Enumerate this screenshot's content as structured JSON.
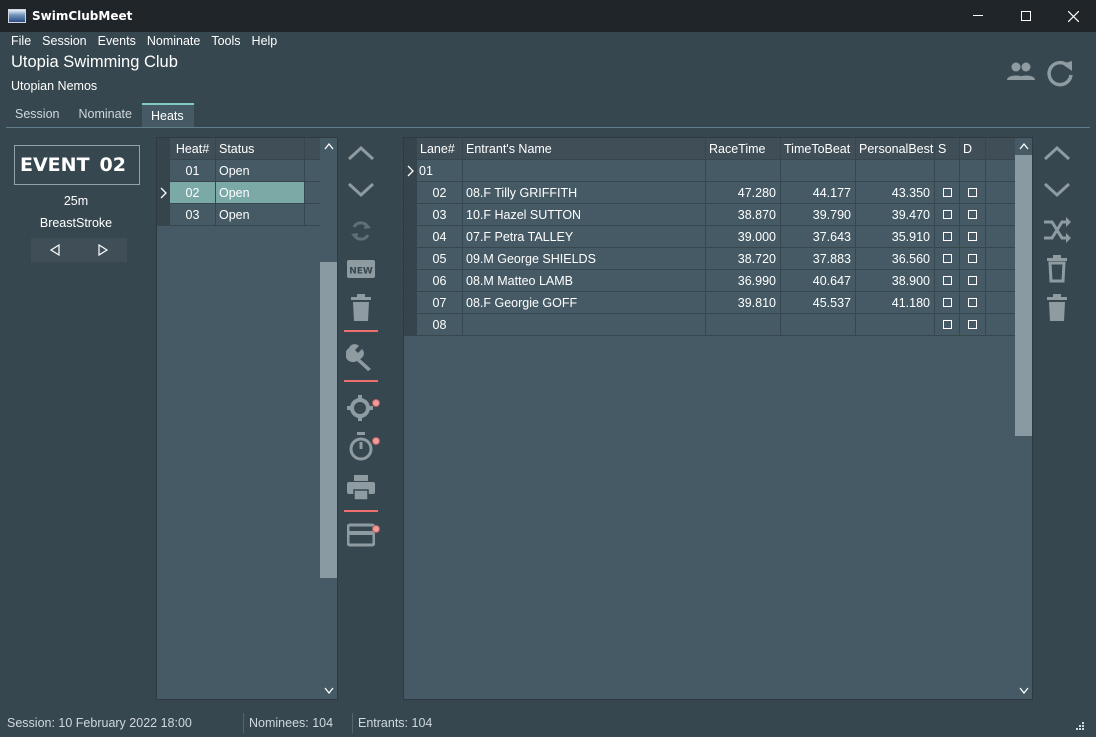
{
  "window": {
    "title": "SwimClubMeet"
  },
  "menu": [
    "File",
    "Session",
    "Events",
    "Nominate",
    "Tools",
    "Help"
  ],
  "header": {
    "club_name": "Utopia Swimming Club",
    "team_name": "Utopian Nemos"
  },
  "tabs": [
    {
      "label": "Session",
      "active": false
    },
    {
      "label": "Nominate",
      "active": false
    },
    {
      "label": "Heats",
      "active": true
    }
  ],
  "event": {
    "label": "EVENT",
    "number": "02",
    "distance": "25m",
    "stroke": "BreastStroke"
  },
  "heats": {
    "columns": [
      "Heat#",
      "Status"
    ],
    "rows": [
      {
        "heat": "01",
        "status": "Open"
      },
      {
        "heat": "02",
        "status": "Open"
      },
      {
        "heat": "03",
        "status": "Open"
      }
    ]
  },
  "lanes": {
    "columns": [
      "Lane#",
      "Entrant's Name",
      "RaceTime",
      "TimeToBeat",
      "PersonalBest",
      "S",
      "D"
    ],
    "rows": [
      {
        "lane": "01",
        "name": "",
        "race": "",
        "ttb": "",
        "pb": ""
      },
      {
        "lane": "02",
        "name": "08.F  Tilly GRIFFITH",
        "race": "47.280",
        "ttb": "44.177",
        "pb": "43.350"
      },
      {
        "lane": "03",
        "name": "10.F  Hazel SUTTON",
        "race": "38.870",
        "ttb": "39.790",
        "pb": "39.470"
      },
      {
        "lane": "04",
        "name": "07.F  Petra TALLEY",
        "race": "39.000",
        "ttb": "37.643",
        "pb": "35.910"
      },
      {
        "lane": "05",
        "name": "09.M  George SHIELDS",
        "race": "38.720",
        "ttb": "37.883",
        "pb": "36.560"
      },
      {
        "lane": "06",
        "name": "08.M  Matteo LAMB",
        "race": "36.990",
        "ttb": "40.647",
        "pb": "38.900"
      },
      {
        "lane": "07",
        "name": "08.F  Georgie GOFF",
        "race": "39.810",
        "ttb": "45.537",
        "pb": "41.180"
      },
      {
        "lane": "08",
        "name": "",
        "race": "",
        "ttb": "",
        "pb": ""
      }
    ]
  },
  "status": {
    "session": "Session: 10 February 2022 18:00",
    "nominees": "Nominees: 104",
    "entrants": "Entrants: 104"
  },
  "colors": {
    "bg": "#37474f",
    "panel": "#455a64",
    "selected": "#7aa9a6",
    "accent_red": "#f06e6e"
  }
}
